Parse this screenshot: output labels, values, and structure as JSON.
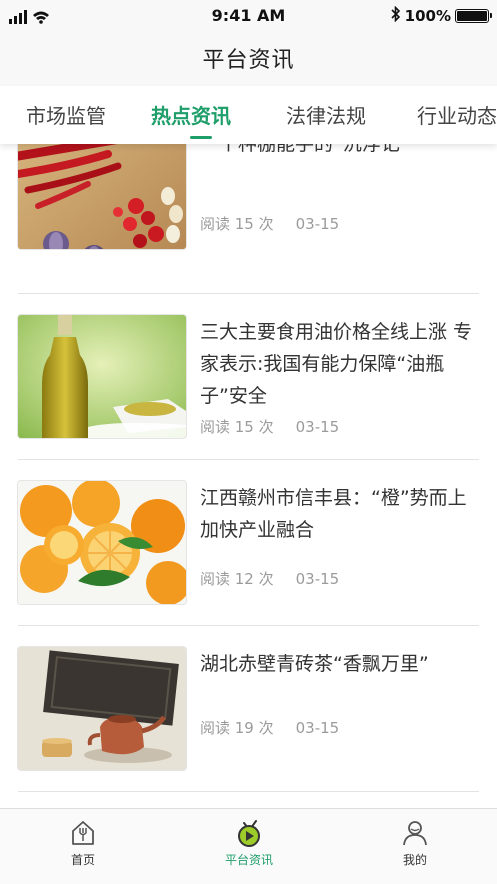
{
  "status_bar": {
    "time": "9:41 AM",
    "battery": "100%"
  },
  "nav": {
    "title": "平台资讯"
  },
  "tabs": [
    {
      "label": "市场监管"
    },
    {
      "label": "热点资讯"
    },
    {
      "label": "法律法规"
    },
    {
      "label": "行业动态"
    }
  ],
  "active_tab": "热点资讯",
  "articles": [
    {
      "title": "一个种棚能手的“沉浮记”",
      "reads": "阅读 15 次",
      "date": "03-15",
      "image": "chili-peppers-garlic-photo"
    },
    {
      "title": "三大主要食用油价格全线上涨 专家表示:我国有能力保障“油瓶子”安全",
      "reads": "阅读 15 次",
      "date": "03-15",
      "image": "olive-oil-bottle-photo"
    },
    {
      "title": "江西赣州市信丰县：“橙”势而上加快产业融合",
      "reads": "阅读 12 次",
      "date": "03-15",
      "image": "oranges-photo"
    },
    {
      "title": "湖北赤壁青砖茶“香飘万里”",
      "reads": "阅读 19 次",
      "date": "03-15",
      "image": "brick-tea-teapot-photo"
    }
  ],
  "tabbar": [
    {
      "label": "首页",
      "icon": "home-icon"
    },
    {
      "label": "平台资讯",
      "icon": "news-icon"
    },
    {
      "label": "我的",
      "icon": "profile-icon"
    }
  ],
  "colors": {
    "accent": "#1f9e6a",
    "meta_text": "#9b9b9b",
    "background": "#ffffff"
  }
}
